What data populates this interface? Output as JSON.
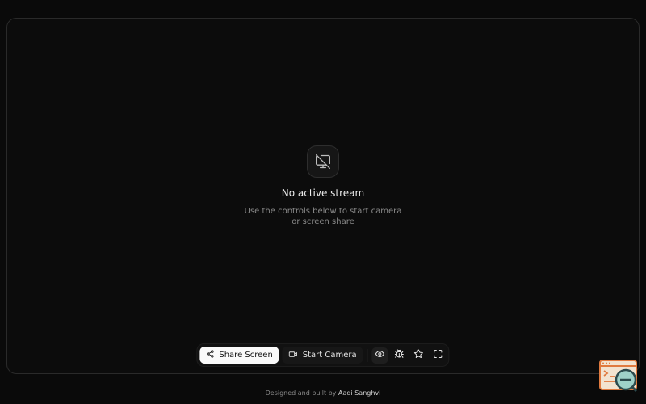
{
  "empty_state": {
    "icon": "monitor-off-icon",
    "title": "No active stream",
    "description": "Use the controls below to start camera or screen share"
  },
  "toolbar": {
    "share_label": "Share Screen",
    "share_icon": "share-icon",
    "camera_label": "Start Camera",
    "camera_icon": "video-camera-icon",
    "icon_buttons": [
      "eye-icon",
      "bug-icon",
      "star-icon",
      "fullscreen-icon"
    ]
  },
  "footer": {
    "prefix": "Designed and built by",
    "author": "Aadi Sanghvi"
  },
  "colors": {
    "background": "#0a0a0a",
    "primary_button": "#fafafa",
    "widget_accent": "#e07a3f"
  }
}
